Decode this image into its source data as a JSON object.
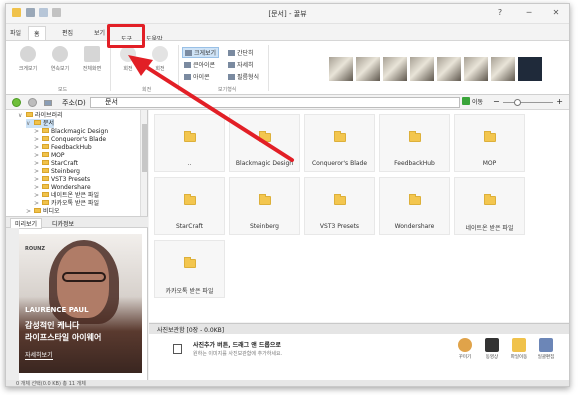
{
  "window": {
    "title": "[문서] - 꿀뷰",
    "min": "─",
    "close": "✕",
    "help": "?"
  },
  "tabs": [
    "파일",
    "홈",
    "편집",
    "보기",
    "도구",
    "도움말"
  ],
  "ribbon": {
    "buttons": [
      "크게보기",
      "연속보기",
      "전체화면",
      "회전",
      "회전"
    ],
    "groups": [
      "모드",
      "회전",
      "보기형식"
    ],
    "view_options": [
      "크게보기",
      "간단히",
      "큰아이콘",
      "자세히",
      "아이콘",
      "필름형식"
    ]
  },
  "address": {
    "label": "주소(D)",
    "value": "문서",
    "move": "이동"
  },
  "tree": [
    {
      "label": "라이브러리",
      "level": 0,
      "expander": "∨"
    },
    {
      "label": "문서",
      "level": 1,
      "expander": "∨",
      "selected": true
    },
    {
      "label": "Blackmagic Design",
      "level": 2,
      "expander": ">"
    },
    {
      "label": "Conqueror's Blade",
      "level": 2,
      "expander": ">"
    },
    {
      "label": "FeedbackHub",
      "level": 2,
      "expander": ">"
    },
    {
      "label": "MOP",
      "level": 2,
      "expander": ">"
    },
    {
      "label": "StarCraft",
      "level": 2,
      "expander": ">"
    },
    {
      "label": "Steinberg",
      "level": 2,
      "expander": ">"
    },
    {
      "label": "VST3 Presets",
      "level": 2,
      "expander": ">"
    },
    {
      "label": "Wondershare",
      "level": 2,
      "expander": ">"
    },
    {
      "label": "네이트온 받은 파일",
      "level": 2,
      "expander": ">"
    },
    {
      "label": "카카오톡 받은 파일",
      "level": 2,
      "expander": ">"
    },
    {
      "label": "비디오",
      "level": 1,
      "expander": ">"
    }
  ],
  "panel_tabs": {
    "preview": "미리보기",
    "info": "디카정보"
  },
  "ad": {
    "brand": "ROUNZ",
    "line1": "LAURENCE PAUL",
    "line2": "감성적인 케니다",
    "line3": "라이프스타일 아이웨어",
    "link": "자세히보기"
  },
  "files": [
    {
      "label": ".."
    },
    {
      "label": "Blackmagic Design"
    },
    {
      "label": "Conqueror's Blade"
    },
    {
      "label": "FeedbackHub"
    },
    {
      "label": "MOP"
    },
    {
      "label": "StarCraft"
    },
    {
      "label": "Steinberg"
    },
    {
      "label": "VST3 Presets"
    },
    {
      "label": "Wondershare"
    },
    {
      "label": "네이트온 받은 파일"
    },
    {
      "label": "카카오톡 받은 파일"
    }
  ],
  "album": {
    "header": "사진보관함 [0장 - 0.0KB]",
    "msg1": "사진추가 버튼, 드래그 앤 드롭으로",
    "msg2": "원하는 이미지를 사진보관함에 추가하세요.",
    "tools": [
      "꾸미기",
      "동영상",
      "파일이동",
      "일괄편집"
    ]
  },
  "status": "0 개체 선택(0.0 KB)      총 11 개체",
  "colors": {
    "accent": "#e21f26",
    "folder": "#f3c64f",
    "selection": "#cde3f7"
  }
}
